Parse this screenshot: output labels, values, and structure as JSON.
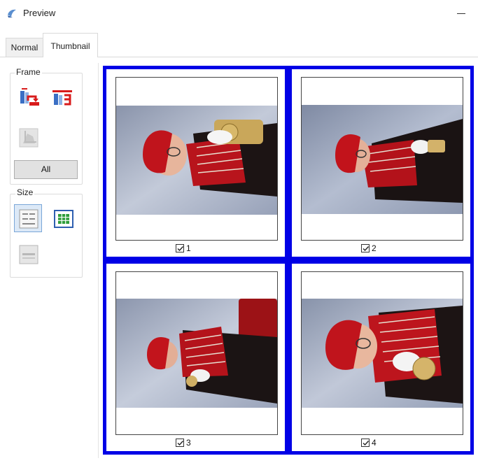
{
  "window": {
    "title": "Preview",
    "icon": "preview-app-icon"
  },
  "tabs": [
    {
      "label": "Normal",
      "selected": false
    },
    {
      "label": "Thumbnail",
      "selected": true
    }
  ],
  "frame_group": {
    "label": "Frame",
    "rotate_left_icon": "rotate-left-icon",
    "rotate_right_icon": "rotate-right-icon",
    "crop_icon": "crop-icon",
    "all_label": "All"
  },
  "size_group": {
    "label": "Size",
    "large_thumbnail_icon": "large-thumbnail-icon",
    "grid_icon": "grid-thumbnail-icon",
    "single_icon": "single-view-icon"
  },
  "thumbnails": [
    {
      "number": "1",
      "checked": true
    },
    {
      "number": "2",
      "checked": true
    },
    {
      "number": "3",
      "checked": true
    },
    {
      "number": "4",
      "checked": true
    }
  ],
  "colors": {
    "selection": "#0000e6",
    "uniform_red": "#c41a1a",
    "backdrop": "#b9c3d6"
  }
}
